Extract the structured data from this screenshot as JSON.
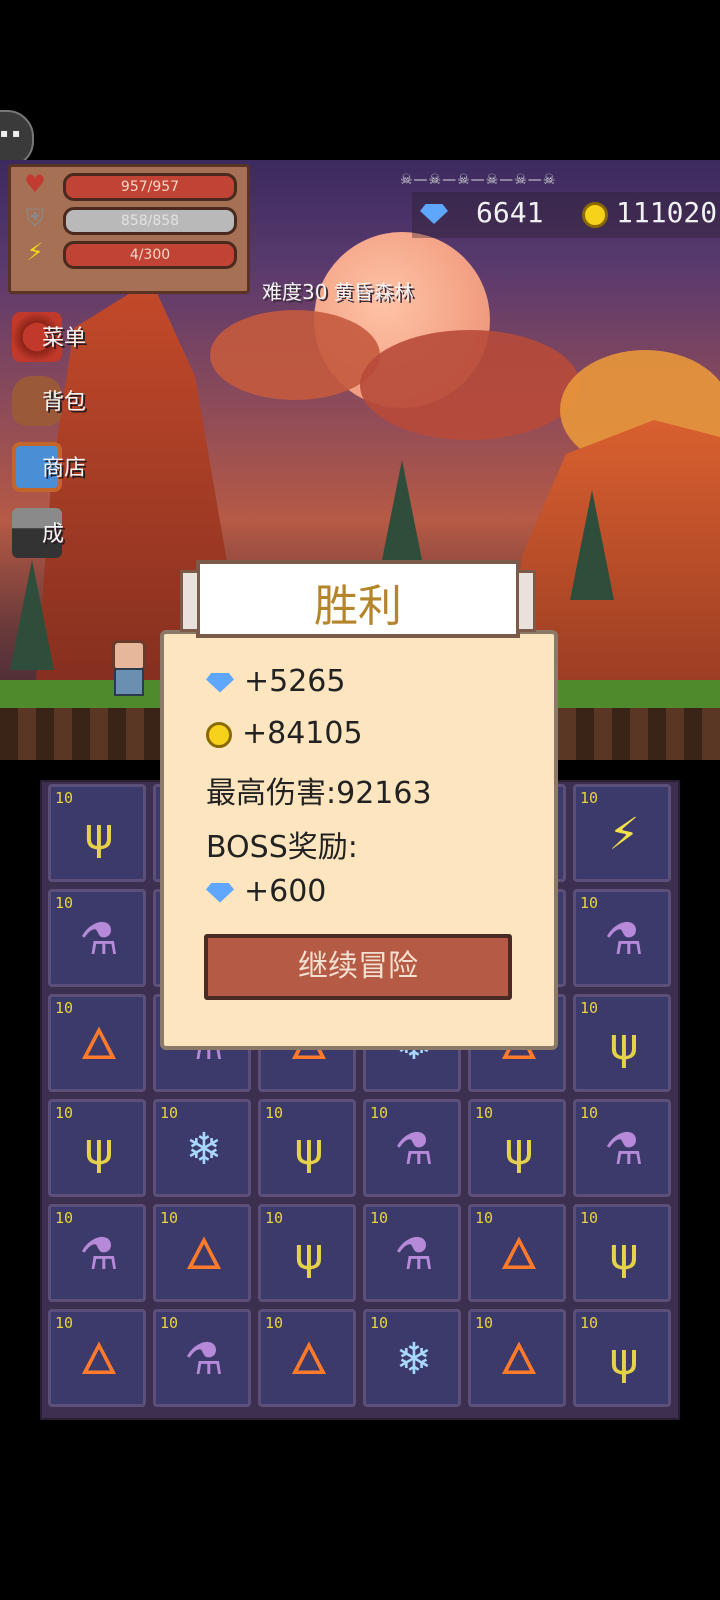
{
  "stats": {
    "hp": "957/957",
    "shield": "858/858",
    "energy": "4/300"
  },
  "currency": {
    "gems": "6641",
    "coins": "111020"
  },
  "stage": "难度30 黄昏森林",
  "menu": {
    "items": [
      {
        "label": "菜单",
        "icon": "flower-menu-icon"
      },
      {
        "label": "背包",
        "icon": "bag-icon"
      },
      {
        "label": "商店",
        "icon": "shop-icon"
      },
      {
        "label": "成",
        "icon": "anvil-icon"
      }
    ]
  },
  "dialog": {
    "title": "胜利",
    "gems_reward": "+5265",
    "coins_reward": "+84105",
    "max_damage": "最高伤害:92163",
    "boss_reward_label": "BOSS奖励:",
    "boss_gems": "+600",
    "continue_label": "继续冒险"
  },
  "grid": {
    "level": "10",
    "items": [
      "lightning-trident",
      "fire-staff",
      "lightning-trident",
      "potion",
      "lightning-trident",
      "lightning-orb",
      "potion",
      "fire-staff",
      "ice-staff",
      "ice-staff",
      "lightning-trident",
      "potion",
      "fire-staff",
      "potion",
      "fire-staff",
      "ice-staff",
      "fire-staff",
      "lightning-trident",
      "lightning-trident",
      "ice-staff",
      "lightning-trident",
      "potion",
      "lightning-trident",
      "potion",
      "potion",
      "fire-staff",
      "lightning-trident",
      "potion",
      "fire-staff",
      "lightning-trident",
      "fire-staff",
      "potion",
      "fire-staff",
      "ice-staff",
      "fire-staff",
      "lightning-trident"
    ]
  }
}
